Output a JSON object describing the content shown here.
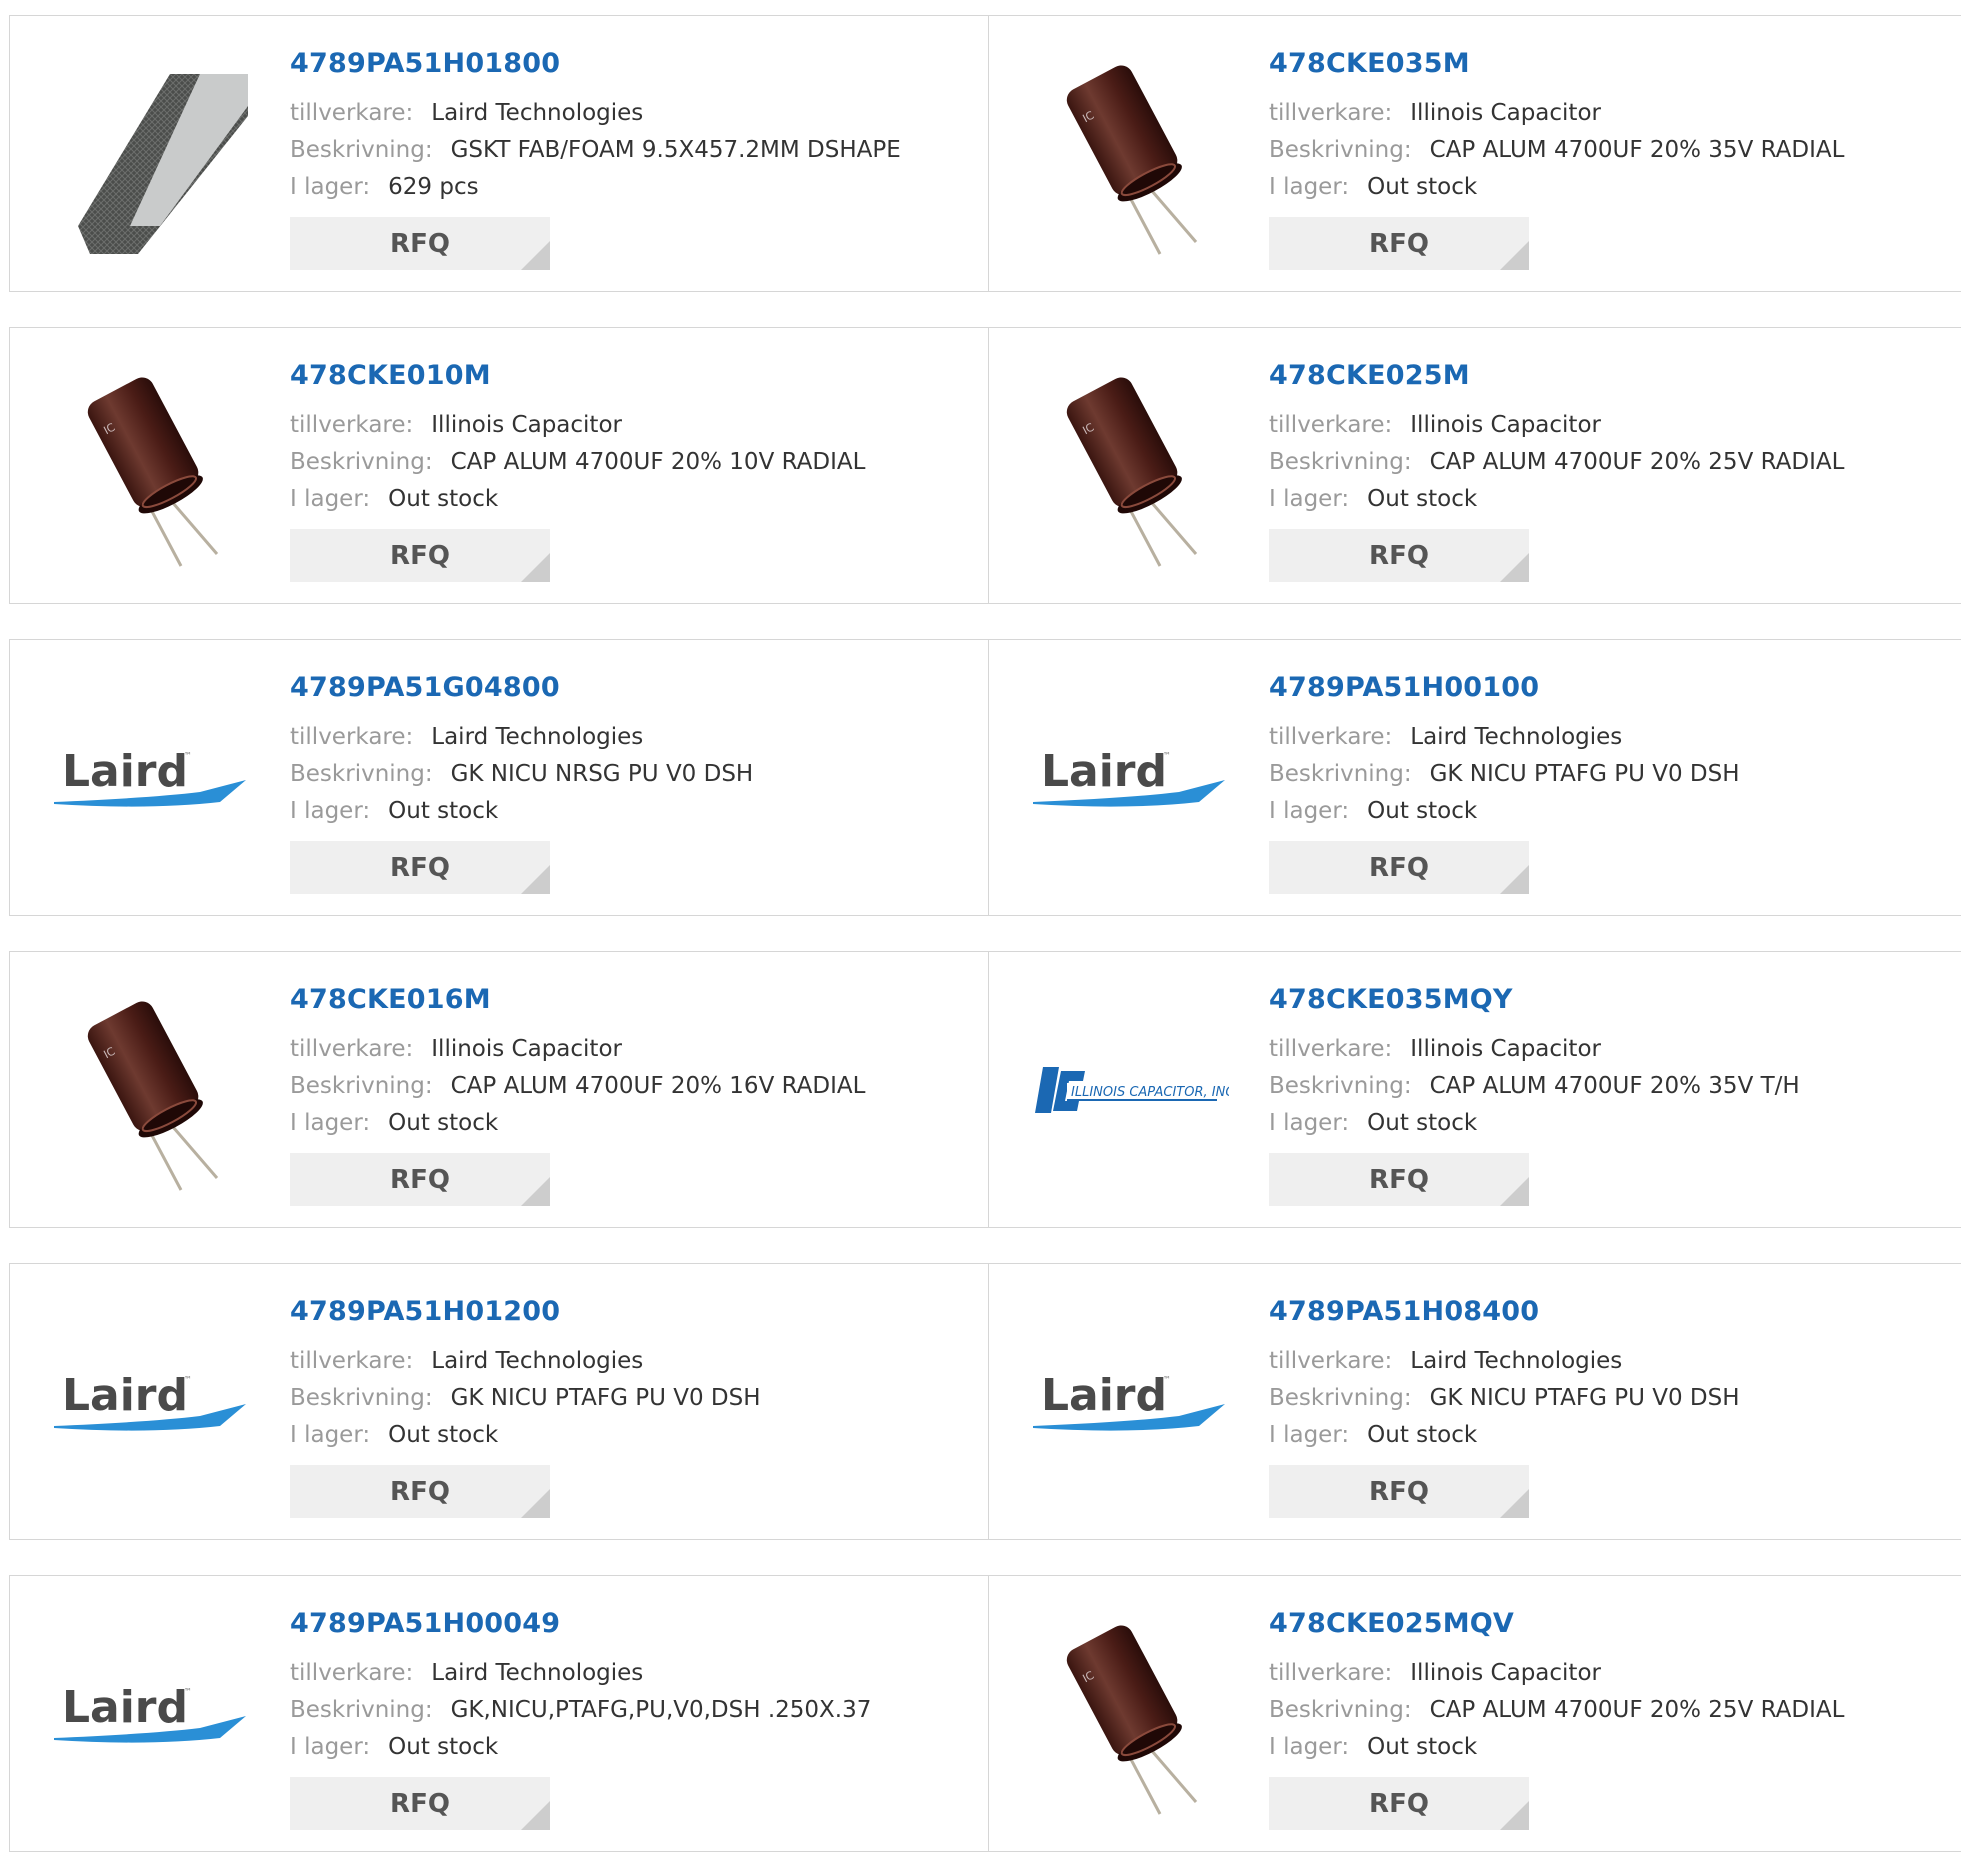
{
  "labels": {
    "manufacturer": "tillverkare:",
    "description": "Beskrivning:",
    "stock": "I lager:",
    "rfq": "RFQ"
  },
  "colors": {
    "part_link": "#1b68b3",
    "label_gray": "#9a9a9a",
    "button_bg": "#efefef"
  },
  "products": [
    {
      "part": "4789PA51H01800",
      "manufacturer": "Laird Technologies",
      "description": "GSKT FAB/FOAM 9.5X457.2MM DSHAPE",
      "stock": "629 pcs",
      "image": "gasket-photo"
    },
    {
      "part": "478CKE035M",
      "manufacturer": "Illinois Capacitor",
      "description": "CAP ALUM 4700UF 20% 35V RADIAL",
      "stock": "Out stock",
      "image": "capacitor-photo"
    },
    {
      "part": "478CKE010M",
      "manufacturer": "Illinois Capacitor",
      "description": "CAP ALUM 4700UF 20% 10V RADIAL",
      "stock": "Out stock",
      "image": "capacitor-photo"
    },
    {
      "part": "478CKE025M",
      "manufacturer": "Illinois Capacitor",
      "description": "CAP ALUM 4700UF 20% 25V RADIAL",
      "stock": "Out stock",
      "image": "capacitor-photo"
    },
    {
      "part": "4789PA51G04800",
      "manufacturer": "Laird Technologies",
      "description": "GK NICU NRSG PU V0 DSH",
      "stock": "Out stock",
      "image": "laird-logo"
    },
    {
      "part": "4789PA51H00100",
      "manufacturer": "Laird Technologies",
      "description": "GK NICU PTAFG PU V0 DSH",
      "stock": "Out stock",
      "image": "laird-logo"
    },
    {
      "part": "478CKE016M",
      "manufacturer": "Illinois Capacitor",
      "description": "CAP ALUM 4700UF 20% 16V RADIAL",
      "stock": "Out stock",
      "image": "capacitor-photo"
    },
    {
      "part": "478CKE035MQY",
      "manufacturer": "Illinois Capacitor",
      "description": "CAP ALUM 4700UF 20% 35V T/H",
      "stock": "Out stock",
      "image": "illinois-capacitor-logo"
    },
    {
      "part": "4789PA51H01200",
      "manufacturer": "Laird Technologies",
      "description": "GK NICU PTAFG PU V0 DSH",
      "stock": "Out stock",
      "image": "laird-logo"
    },
    {
      "part": "4789PA51H08400",
      "manufacturer": "Laird Technologies",
      "description": "GK NICU PTAFG PU V0 DSH",
      "stock": "Out stock",
      "image": "laird-logo"
    },
    {
      "part": "4789PA51H00049",
      "manufacturer": "Laird Technologies",
      "description": "GK,NICU,PTAFG,PU,V0,DSH .250X.37",
      "stock": "Out stock",
      "image": "laird-logo"
    },
    {
      "part": "478CKE025MQV",
      "manufacturer": "Illinois Capacitor",
      "description": "CAP ALUM 4700UF 20% 25V RADIAL",
      "stock": "Out stock",
      "image": "capacitor-photo"
    }
  ]
}
